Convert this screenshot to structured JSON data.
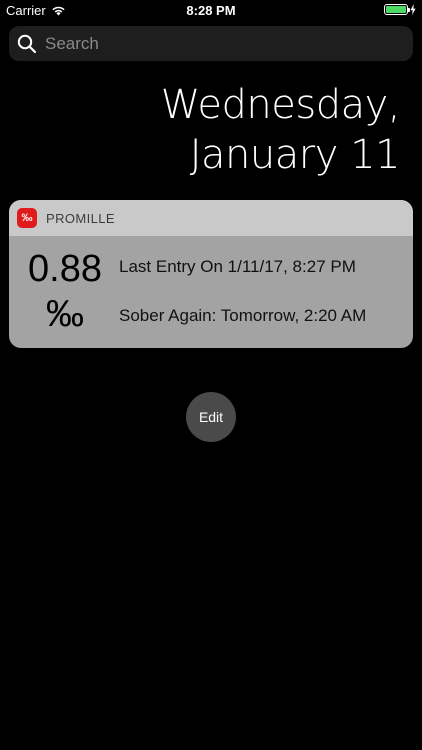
{
  "status_bar": {
    "carrier": "Carrier",
    "time": "8:28 PM",
    "battery_color": "#4cd964"
  },
  "search": {
    "placeholder": "Search"
  },
  "date": {
    "line1": "Wednesday,",
    "line2": "January 11"
  },
  "widget": {
    "app_icon_glyph": "‰",
    "app_name": "PROMILLE",
    "value": "0.88",
    "unit": "‰",
    "last_entry": "Last Entry On 1/11/17, 8:27 PM",
    "sober_again": "Sober Again: Tomorrow, 2:20 AM",
    "icon_color": "#e01b1b"
  },
  "edit_button": {
    "label": "Edit"
  }
}
